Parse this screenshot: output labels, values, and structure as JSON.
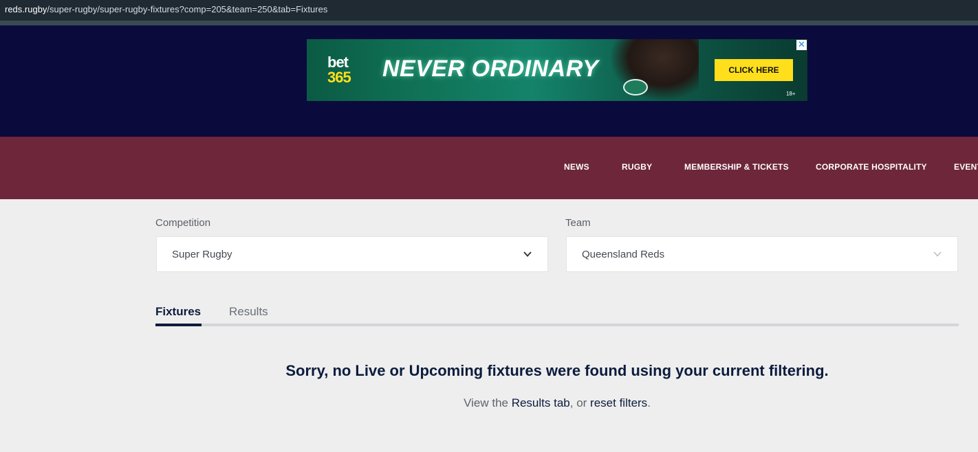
{
  "browser": {
    "url_host": "reds.rugby",
    "url_path": "/super-rugby/super-rugby-fixtures?comp=205&team=250&tab=Fixtures"
  },
  "ad": {
    "logo_line1": "bet",
    "logo_line2": "365",
    "headline": "NEVER ORDINARY",
    "cta": "CLICK HERE",
    "age_notice": "18+",
    "close_symbol": "✕",
    "colors": {
      "cta": "#ffdf1b",
      "logo_accent": "#ffdf1b"
    }
  },
  "nav": {
    "items": [
      {
        "label": "NEWS"
      },
      {
        "label": "RUGBY"
      },
      {
        "label": "MEMBERSHIP & TICKETS"
      },
      {
        "label": "CORPORATE HOSPITALITY"
      },
      {
        "label": "EVENT"
      }
    ],
    "colors": {
      "background": "#6e263b"
    }
  },
  "filters": {
    "competition": {
      "label": "Competition",
      "value": "Super Rugby"
    },
    "team": {
      "label": "Team",
      "value": "Queensland Reds"
    }
  },
  "tabs": [
    {
      "label": "Fixtures",
      "active": true
    },
    {
      "label": "Results",
      "active": false
    }
  ],
  "empty_state": {
    "title": "Sorry, no Live or Upcoming fixtures were found using your current filtering.",
    "prefix": "View the ",
    "results_link": "Results tab",
    "middle": ", or ",
    "reset_link": "reset filters",
    "suffix": "."
  },
  "colors": {
    "header_background": "#0a0a3d",
    "primary_text": "#0c1c3d"
  }
}
